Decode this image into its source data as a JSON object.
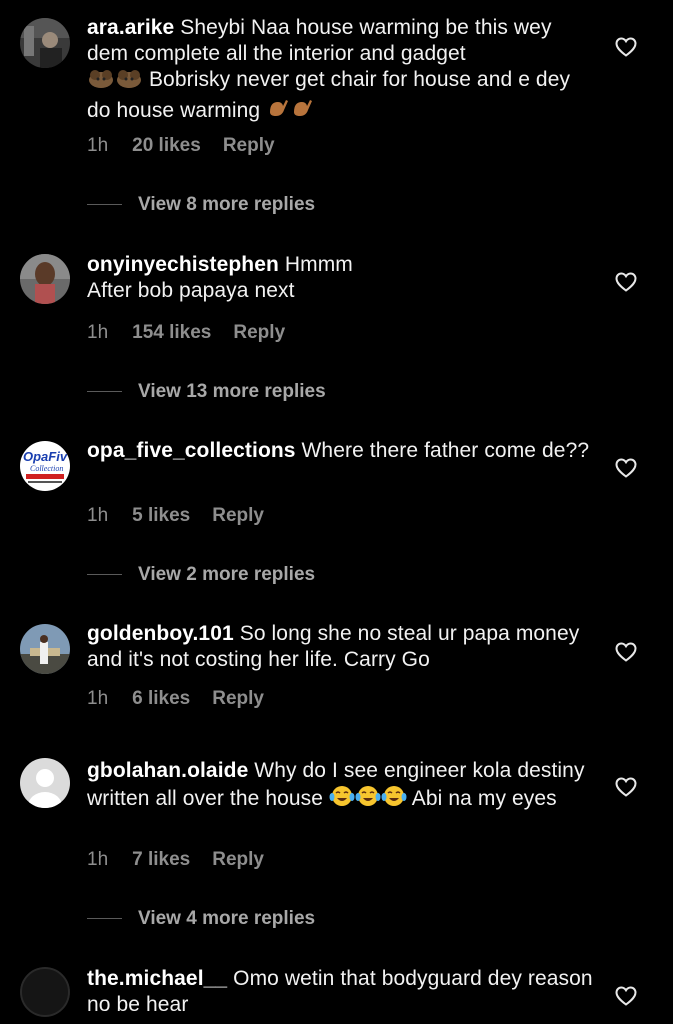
{
  "comments": [
    {
      "username": "ara.arike",
      "text_a": "Sheybi Naa house warming be this wey dem complete all the interior and gadget",
      "text_b": "Bobrisky never get chair for house and e dey do house warming",
      "emoji_a": "lion-emoji lion-emoji",
      "emoji_b": "pinching-hand-emoji pinching-hand-emoji",
      "time": "1h",
      "likes": "20 likes",
      "reply": "Reply",
      "view_replies": "View 8 more replies"
    },
    {
      "username": "onyinyechistephen",
      "text_a": "Hmmm",
      "text_b": "After bob papaya next",
      "time": "1h",
      "likes": "154 likes",
      "reply": "Reply",
      "view_replies": "View 13 more replies"
    },
    {
      "username": "opa_five_collections",
      "text_a": "Where there father come de??",
      "avatar_logo": "OpaFiv",
      "avatar_logo_sub": "Collection",
      "time": "1h",
      "likes": "5 likes",
      "reply": "Reply",
      "view_replies": "View 2 more replies"
    },
    {
      "username": "goldenboy.101",
      "text_a": "So long she no steal ur papa money and it's not costing her life. Carry Go",
      "time": "1h",
      "likes": "6 likes",
      "reply": "Reply"
    },
    {
      "username": "gbolahan.olaide",
      "text_a": "Why do I see engineer kola destiny written all over the house",
      "text_b": "Abi na my eyes",
      "emoji_a": "tears-of-joy-emoji x3",
      "time": "1h",
      "likes": "7 likes",
      "reply": "Reply",
      "view_replies": "View 4 more replies"
    },
    {
      "username": "the.michael__",
      "text_a": "Omo wetin that bodyguard dey reason no be hear"
    }
  ],
  "icons": {
    "heart": "heart-outline-icon"
  },
  "colors": {
    "background": "#000000",
    "text": "#f2f2f2",
    "meta": "#8e8e8e"
  }
}
